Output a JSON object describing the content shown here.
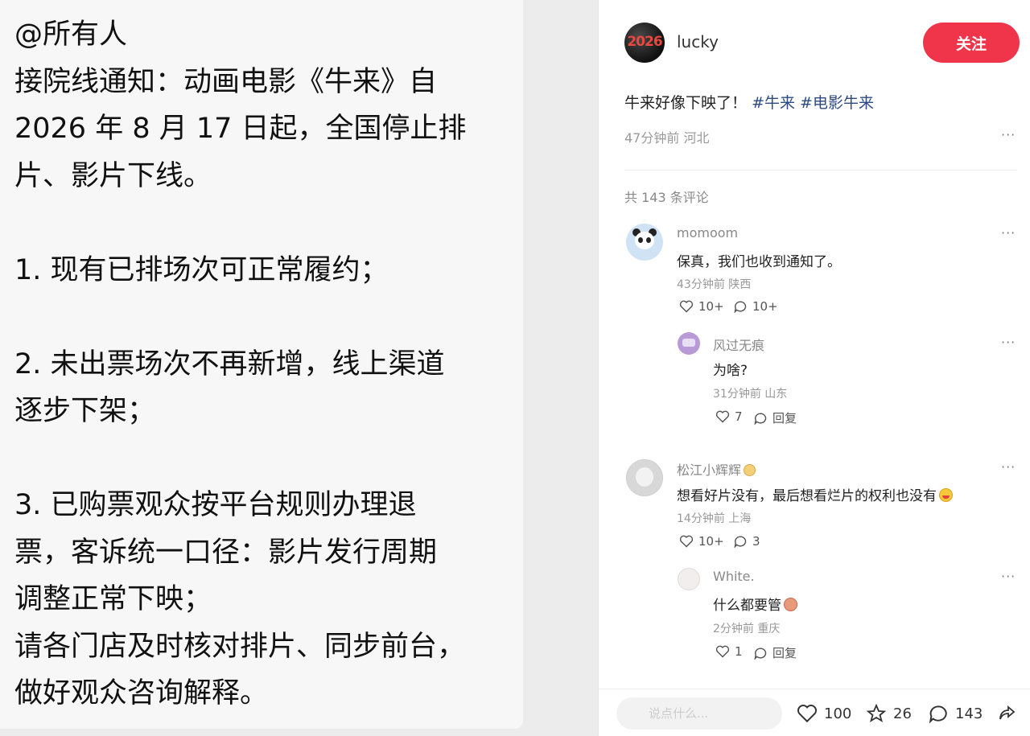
{
  "notice": {
    "lines": [
      "@所有人",
      "接院线通知：动画电影《牛来》自",
      "2026 年 8 月 17 日起，全国停止排",
      "片、影片下线。",
      "",
      "1.  现有已排场次可正常履约；",
      "",
      "2.  未出票场次不再新增，线上渠道",
      "逐步下架；",
      "",
      "3.  已购票观众按平台规则办理退",
      "票，客诉统一口径：影片发行周期",
      "调整正常下映；",
      "请各门店及时核对排片、同步前台，",
      "做好观众咨询解释。"
    ]
  },
  "post": {
    "author": {
      "avatar_text": "2026",
      "name": "lucky"
    },
    "follow_label": "关注",
    "text": "牛来好像下映了！",
    "tags": [
      "#牛来",
      "#电影牛来"
    ],
    "meta": "47分钟前 河北",
    "more": "···",
    "comment_count": "共 143 条评论"
  },
  "comments": [
    {
      "name": "momoom",
      "text": "保真，我们也收到通知了。",
      "meta": "43分钟前 陕西",
      "likes": "10+",
      "replies": "10+",
      "more": "···",
      "reply": {
        "name": "风过无痕",
        "text": "为啥?",
        "meta": "31分钟前 山东",
        "likes": "7",
        "reply_label": "回复",
        "more": "···"
      }
    },
    {
      "name": "松江小辉辉",
      "text": "想看好片没有，最后想看烂片的权利也没有",
      "meta": "14分钟前 上海",
      "likes": "10+",
      "replies": "3",
      "more": "···",
      "reply": {
        "name": "White.",
        "text": "什么都要管",
        "meta": "2分钟前 重庆",
        "likes": "1",
        "reply_label": "回复",
        "more": "···"
      }
    }
  ],
  "bottom_bar": {
    "input_placeholder": "说点什么...",
    "likes": "100",
    "favorites": "26",
    "comments": "143"
  },
  "colors": {
    "follow": "#f0344a",
    "tag": "#2b4a82"
  },
  "icons": [
    "heart-icon",
    "comment-bubble-icon",
    "star-icon",
    "share-icon",
    "more-icon"
  ]
}
